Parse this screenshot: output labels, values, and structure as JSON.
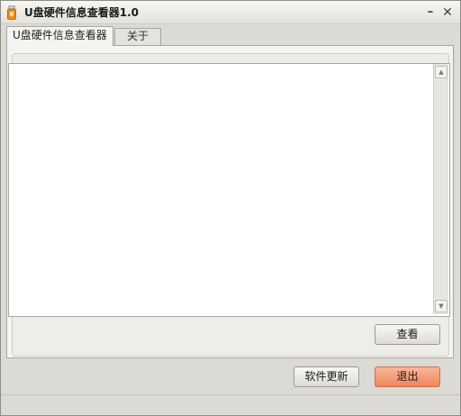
{
  "window": {
    "title": "U盘硬件信息查看器1.0",
    "icon": "usb-drive-icon",
    "minimize_glyph": "–",
    "close_glyph": "✕"
  },
  "tabs": [
    {
      "label": "U盘硬件信息查看器",
      "active": true
    },
    {
      "label": "关于",
      "active": false
    }
  ],
  "info_area": {
    "value": ""
  },
  "buttons": {
    "view_label": "查看",
    "update_label": "软件更新",
    "exit_label": "退出"
  },
  "colors": {
    "exit_button": "#ee8660",
    "window_bg": "#dcdad5"
  }
}
